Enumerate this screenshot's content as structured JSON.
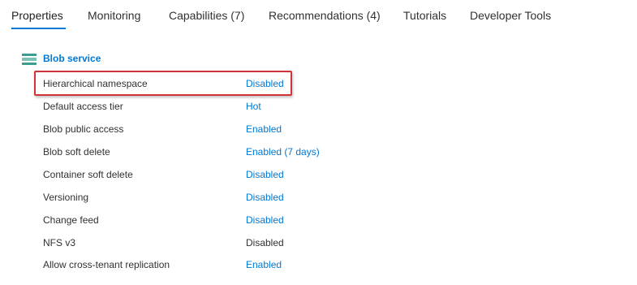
{
  "tabs": [
    {
      "label": "Properties"
    },
    {
      "label": "Monitoring"
    },
    {
      "label": "Capabilities (7)"
    },
    {
      "label": "Recommendations (4)"
    },
    {
      "label": "Tutorials"
    },
    {
      "label": "Developer Tools"
    }
  ],
  "section": {
    "title": "Blob service",
    "icon": "blob-service-icon"
  },
  "rows": [
    {
      "label": "Hierarchical namespace",
      "value": "Disabled",
      "link": true
    },
    {
      "label": "Default access tier",
      "value": "Hot",
      "link": true
    },
    {
      "label": "Blob public access",
      "value": "Enabled",
      "link": true
    },
    {
      "label": "Blob soft delete",
      "value": "Enabled (7 days)",
      "link": true
    },
    {
      "label": "Container soft delete",
      "value": "Disabled",
      "link": true
    },
    {
      "label": "Versioning",
      "value": "Disabled",
      "link": true
    },
    {
      "label": "Change feed",
      "value": "Disabled",
      "link": true
    },
    {
      "label": "NFS v3",
      "value": "Disabled",
      "link": false
    },
    {
      "label": "Allow cross-tenant replication",
      "value": "Enabled",
      "link": true
    }
  ],
  "colors": {
    "accent": "#0078d4",
    "highlight": "#d13438",
    "text": "#323130"
  }
}
